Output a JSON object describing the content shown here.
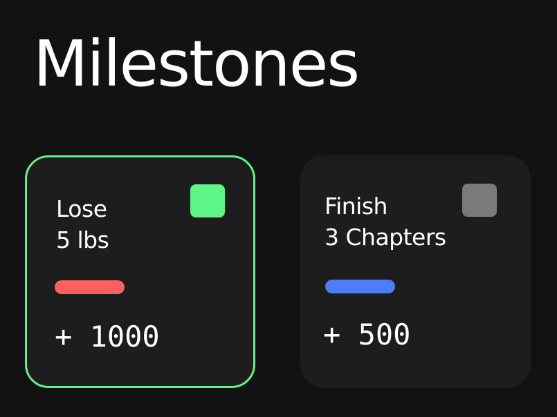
{
  "page": {
    "title": "Milestones"
  },
  "milestones": [
    {
      "title": "Lose\n5 lbs",
      "reward": "+ 1000",
      "selected": true,
      "check_color": "#5ef587",
      "bar_color": "#ff5f61"
    },
    {
      "title": "Finish\n3 Chapters",
      "reward": "+ 500",
      "selected": false,
      "check_color": "#7a7a7a",
      "bar_color": "#4f7cf7"
    }
  ],
  "colors": {
    "background": "#121212",
    "card_background": "#1d1d1d",
    "selected_border": "#66f08a",
    "text": "#ffffff"
  }
}
